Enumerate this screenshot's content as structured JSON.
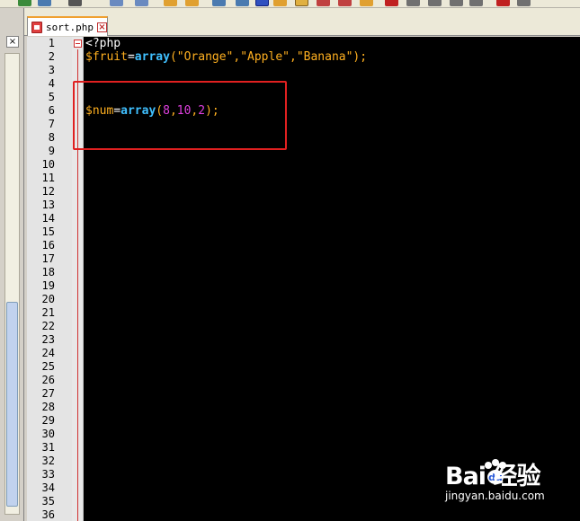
{
  "tab": {
    "label": "sort.php"
  },
  "editor": {
    "lines": [
      {
        "num": "1",
        "tokens": [
          {
            "t": "<?php",
            "c": "tok-tag"
          }
        ]
      },
      {
        "num": "2",
        "tokens": [
          {
            "t": "$fruit",
            "c": "tok-var"
          },
          {
            "t": "=",
            "c": "tok-op"
          },
          {
            "t": "array",
            "c": "tok-kw"
          },
          {
            "t": "(\"Orange\",\"Apple\",\"Banana\");",
            "c": "tok-str"
          }
        ]
      },
      {
        "num": "3",
        "tokens": []
      },
      {
        "num": "4",
        "tokens": []
      },
      {
        "num": "5",
        "tokens": []
      },
      {
        "num": "6",
        "tokens": [
          {
            "t": "$num",
            "c": "tok-var"
          },
          {
            "t": "=",
            "c": "tok-op"
          },
          {
            "t": "array",
            "c": "tok-kw"
          },
          {
            "t": "(",
            "c": "tok-str"
          },
          {
            "t": "8",
            "c": "tok-num"
          },
          {
            "t": ",",
            "c": "tok-str"
          },
          {
            "t": "10",
            "c": "tok-num"
          },
          {
            "t": ",",
            "c": "tok-str"
          },
          {
            "t": "2",
            "c": "tok-num"
          },
          {
            "t": ");",
            "c": "tok-str"
          }
        ]
      },
      {
        "num": "7",
        "tokens": []
      },
      {
        "num": "8",
        "tokens": []
      },
      {
        "num": "9",
        "tokens": []
      },
      {
        "num": "10",
        "tokens": []
      },
      {
        "num": "11",
        "tokens": []
      },
      {
        "num": "12",
        "tokens": []
      },
      {
        "num": "13",
        "tokens": []
      },
      {
        "num": "14",
        "tokens": []
      },
      {
        "num": "15",
        "tokens": []
      },
      {
        "num": "16",
        "tokens": []
      },
      {
        "num": "17",
        "tokens": []
      },
      {
        "num": "18",
        "tokens": []
      },
      {
        "num": "19",
        "tokens": []
      },
      {
        "num": "20",
        "tokens": []
      },
      {
        "num": "21",
        "tokens": []
      },
      {
        "num": "22",
        "tokens": []
      },
      {
        "num": "23",
        "tokens": []
      },
      {
        "num": "24",
        "tokens": []
      },
      {
        "num": "25",
        "tokens": []
      },
      {
        "num": "26",
        "tokens": []
      },
      {
        "num": "27",
        "tokens": []
      },
      {
        "num": "28",
        "tokens": []
      },
      {
        "num": "29",
        "tokens": []
      },
      {
        "num": "30",
        "tokens": []
      },
      {
        "num": "31",
        "tokens": []
      },
      {
        "num": "32",
        "tokens": []
      },
      {
        "num": "33",
        "tokens": []
      },
      {
        "num": "34",
        "tokens": []
      },
      {
        "num": "35",
        "tokens": []
      },
      {
        "num": "36",
        "tokens": []
      }
    ]
  },
  "watermark": {
    "logo": "Bai  经验",
    "url": "jingyan.baidu.com"
  },
  "colors": {
    "background": "#000000",
    "keyword": "#40c0ff",
    "variable": "#ffb020",
    "number": "#e040e0",
    "highlight": "#e02020"
  }
}
